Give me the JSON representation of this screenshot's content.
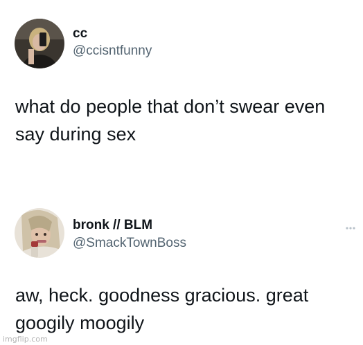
{
  "tweets": [
    {
      "display_name": "cc",
      "handle": "@ccisntfunny",
      "text": "what do people that don’t swear even say during sex"
    },
    {
      "display_name": "bronk // BLM",
      "handle": "@SmackTownBoss",
      "text": "aw, heck. goodness gracious. great googily moogily"
    }
  ],
  "watermark": "imgflip.com",
  "icons": {
    "more": "more-dots-icon"
  },
  "colors": {
    "text": "#0f1419",
    "secondary": "#536471"
  }
}
